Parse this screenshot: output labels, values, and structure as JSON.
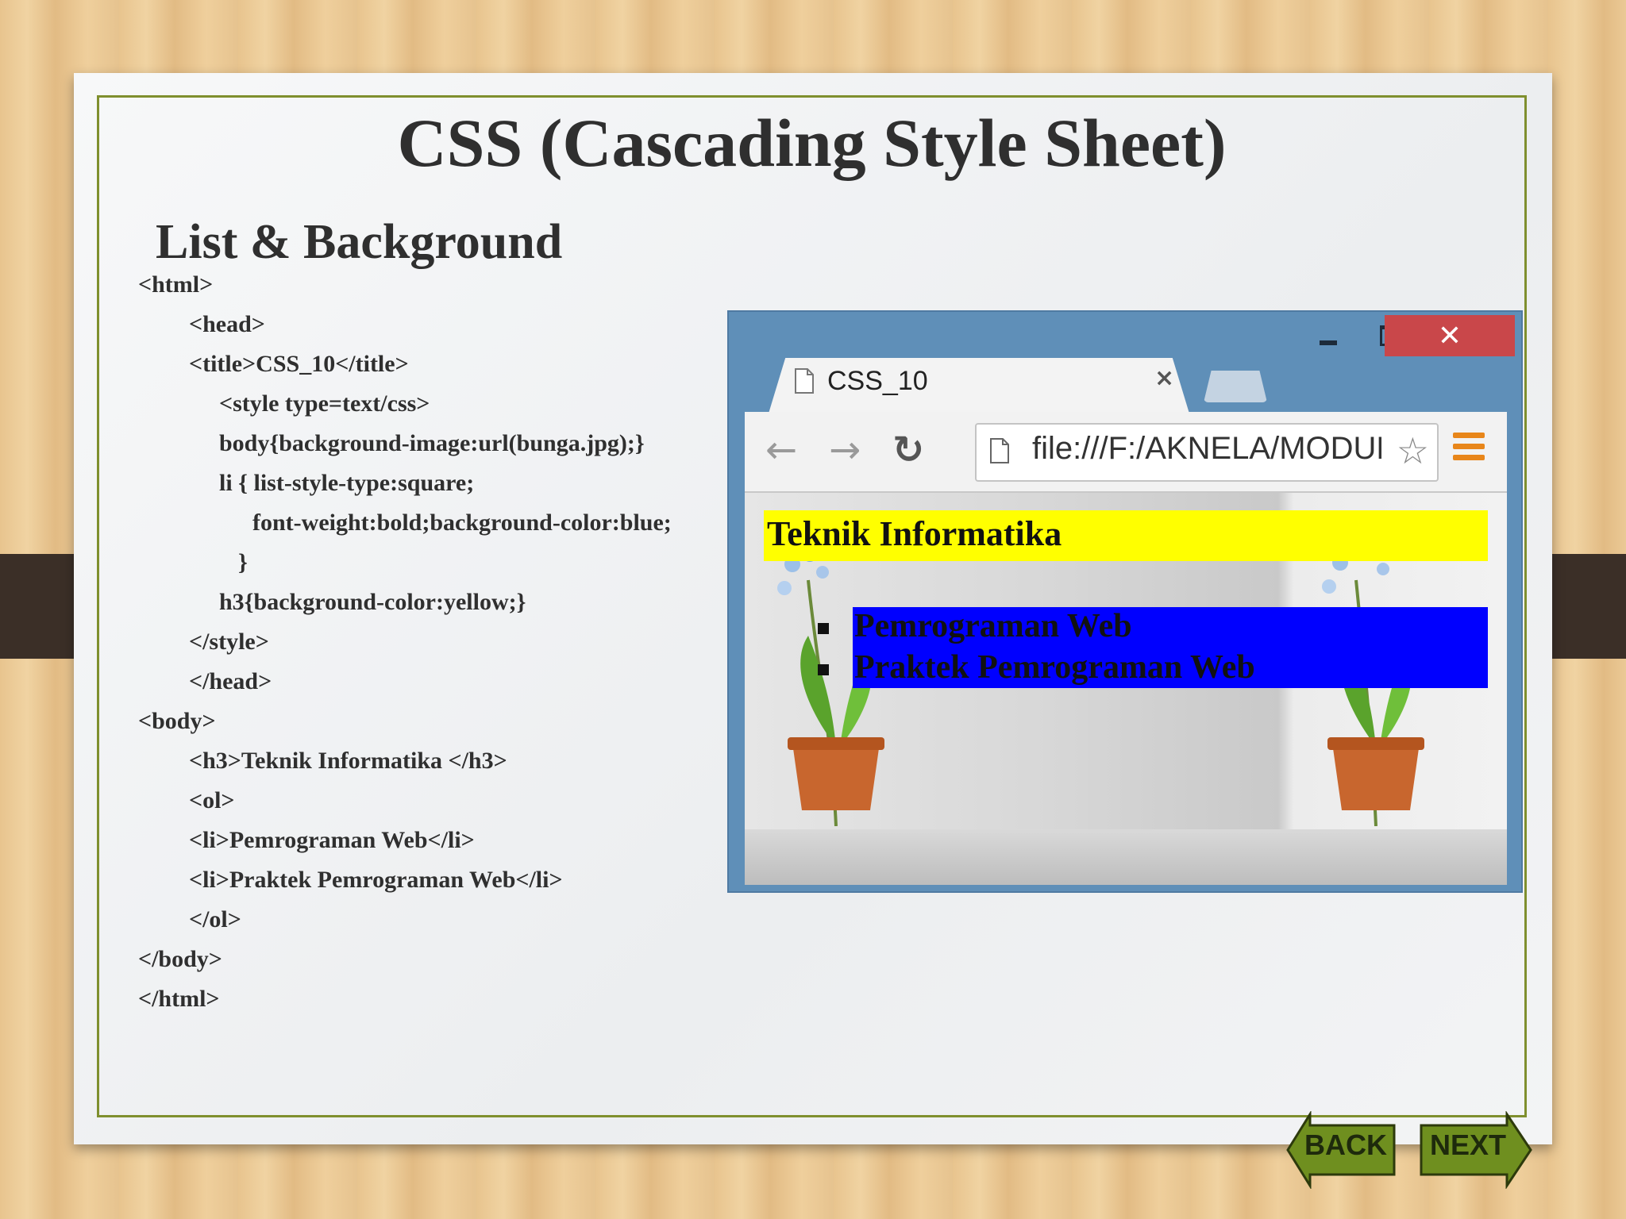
{
  "slide": {
    "title": "CSS (Cascading Style Sheet)",
    "subtitle": "List & Background"
  },
  "code_lines": [
    "<html>",
    "<head>",
    "<title>CSS_10</title>",
    "<style type=text/css>",
    "body{background-image:url(bunga.jpg);}",
    "li { list-style-type:square;",
    "font-weight:bold;background-color:blue;",
    "}",
    "h3{background-color:yellow;}",
    "</style>",
    "</head>",
    "<body>",
    "<h3>Teknik Informatika </h3>",
    "<ol>",
    "<li>Pemrograman Web</li>",
    "<li>Praktek Pemrograman Web</li>",
    "</ol>",
    "</body>",
    "</html>"
  ],
  "browser": {
    "tab_title": "CSS_10",
    "tab_close": "×",
    "url": "file:///F:/AKNELA/MODUL",
    "window_close": "✕",
    "nav_back": "←",
    "nav_forward": "→",
    "nav_reload": "↻",
    "bookmark_star": "☆",
    "page": {
      "heading": "Teknik Informatika",
      "list_items": [
        "Pemrograman Web",
        "Praktek Pemrograman Web"
      ],
      "heading_bg": "#ffff00",
      "list_bg": "#0000ff"
    }
  },
  "nav": {
    "back_label": "BACK",
    "next_label": "NEXT",
    "arrow_color": "#6f8f1f"
  }
}
